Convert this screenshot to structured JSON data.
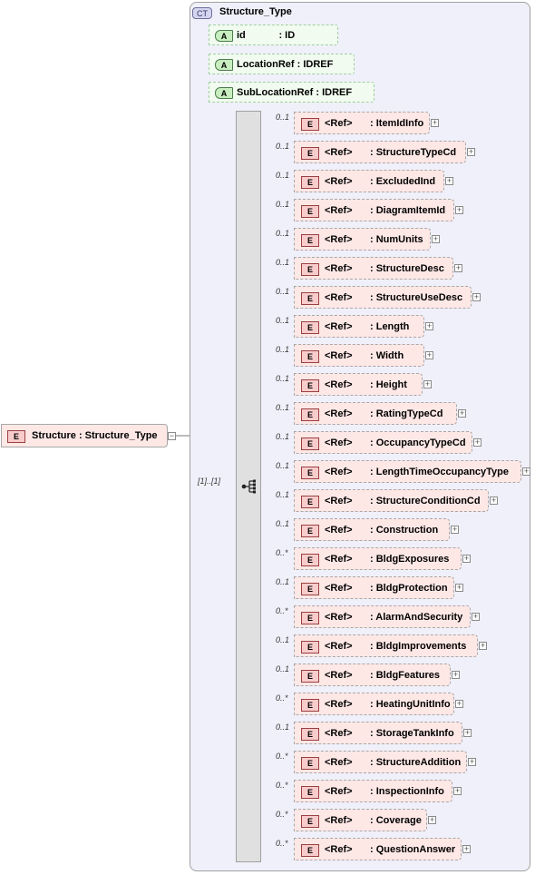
{
  "root_element": {
    "badge": "E",
    "label": "Structure : Structure_Type",
    "collapse": "−"
  },
  "complex_type": {
    "badge": "CT",
    "title": "Structure_Type",
    "attributes": [
      {
        "badge": "A",
        "label": "id            : ID"
      },
      {
        "badge": "A",
        "label": "LocationRef : IDREF"
      },
      {
        "badge": "A",
        "label": "SubLocationRef : IDREF"
      }
    ],
    "sequence": {
      "cardinality": "[1]..[1]",
      "icon": "sequence-icon"
    },
    "elements": [
      {
        "badge": "E",
        "ref": "<Ref>",
        "name": ": ItemIdInfo",
        "card": "0..1"
      },
      {
        "badge": "E",
        "ref": "<Ref>",
        "name": ": StructureTypeCd",
        "card": "0..1"
      },
      {
        "badge": "E",
        "ref": "<Ref>",
        "name": ": ExcludedInd",
        "card": "0..1"
      },
      {
        "badge": "E",
        "ref": "<Ref>",
        "name": ": DiagramItemId",
        "card": "0..1"
      },
      {
        "badge": "E",
        "ref": "<Ref>",
        "name": ": NumUnits",
        "card": "0..1"
      },
      {
        "badge": "E",
        "ref": "<Ref>",
        "name": ": StructureDesc",
        "card": "0..1"
      },
      {
        "badge": "E",
        "ref": "<Ref>",
        "name": ": StructureUseDesc",
        "card": "0..1"
      },
      {
        "badge": "E",
        "ref": "<Ref>",
        "name": ": Length",
        "card": "0..1"
      },
      {
        "badge": "E",
        "ref": "<Ref>",
        "name": ": Width",
        "card": "0..1"
      },
      {
        "badge": "E",
        "ref": "<Ref>",
        "name": ": Height",
        "card": "0..1"
      },
      {
        "badge": "E",
        "ref": "<Ref>",
        "name": ": RatingTypeCd",
        "card": "0..1"
      },
      {
        "badge": "E",
        "ref": "<Ref>",
        "name": ": OccupancyTypeCd",
        "card": "0..1"
      },
      {
        "badge": "E",
        "ref": "<Ref>",
        "name": ": LengthTimeOccupancyType",
        "card": "0..1"
      },
      {
        "badge": "E",
        "ref": "<Ref>",
        "name": ": StructureConditionCd",
        "card": "0..1"
      },
      {
        "badge": "E",
        "ref": "<Ref>",
        "name": ": Construction",
        "card": "0..1"
      },
      {
        "badge": "E",
        "ref": "<Ref>",
        "name": ": BldgExposures",
        "card": "0..*"
      },
      {
        "badge": "E",
        "ref": "<Ref>",
        "name": ": BldgProtection",
        "card": "0..1"
      },
      {
        "badge": "E",
        "ref": "<Ref>",
        "name": ": AlarmAndSecurity",
        "card": "0..*"
      },
      {
        "badge": "E",
        "ref": "<Ref>",
        "name": ": BldgImprovements",
        "card": "0..1"
      },
      {
        "badge": "E",
        "ref": "<Ref>",
        "name": ": BldgFeatures",
        "card": "0..1"
      },
      {
        "badge": "E",
        "ref": "<Ref>",
        "name": ": HeatingUnitInfo",
        "card": "0..*"
      },
      {
        "badge": "E",
        "ref": "<Ref>",
        "name": ": StorageTankInfo",
        "card": "0..1"
      },
      {
        "badge": "E",
        "ref": "<Ref>",
        "name": ": StructureAddition",
        "card": "0..*"
      },
      {
        "badge": "E",
        "ref": "<Ref>",
        "name": ": InspectionInfo",
        "card": "0..*"
      },
      {
        "badge": "E",
        "ref": "<Ref>",
        "name": ": Coverage",
        "card": "0..*"
      },
      {
        "badge": "E",
        "ref": "<Ref>",
        "name": ": QuestionAnswer",
        "card": "0..*"
      }
    ],
    "expand_symbol": "+"
  }
}
